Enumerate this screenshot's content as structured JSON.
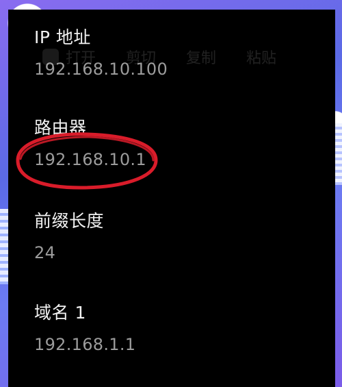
{
  "toolbar": {
    "items": [
      "打开",
      "剪切",
      "复制",
      "粘贴"
    ]
  },
  "network": {
    "ip": {
      "label": "IP 地址",
      "value": "192.168.10.100"
    },
    "router": {
      "label": "路由器",
      "value": "192.168.10.1"
    },
    "prefix": {
      "label": "前缀长度",
      "value": "24"
    },
    "dns1": {
      "label": "域名 1",
      "value": "192.168.1.1"
    }
  },
  "colors": {
    "panel_bg": "#000000",
    "label": "#f2f2f2",
    "value": "#9c9c9c",
    "annotation": "#d91c2a"
  }
}
